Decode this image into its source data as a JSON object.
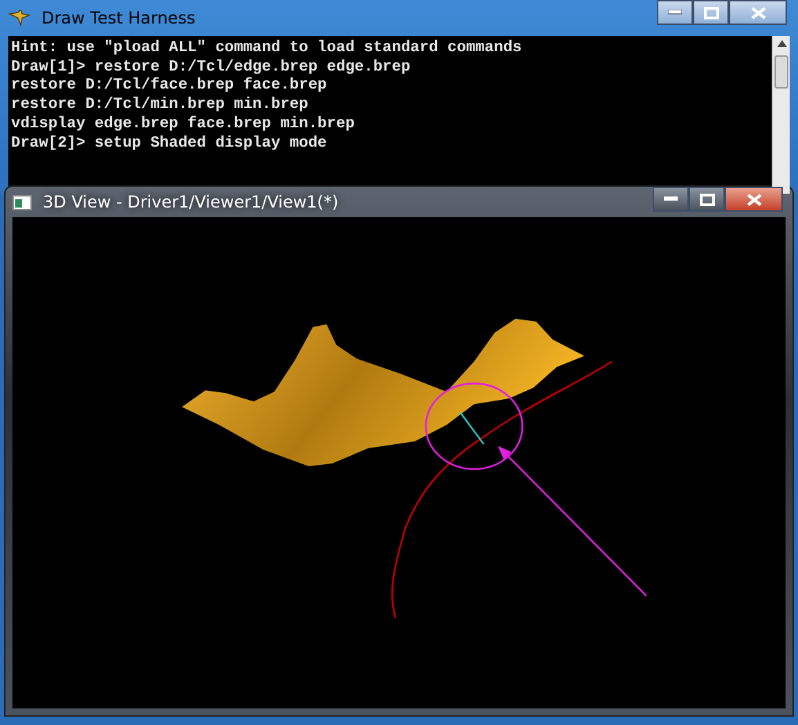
{
  "console_window": {
    "title": "Draw Test Harness",
    "lines": [
      "Hint: use \"pload ALL\" command to load standard commands",
      "Draw[1]> restore D:/Tcl/edge.brep edge.brep",
      "restore D:/Tcl/face.brep face.brep",
      "restore D:/Tcl/min.brep min.brep",
      "vdisplay edge.brep face.brep min.brep",
      "Draw[2]> setup Shaded display mode"
    ]
  },
  "viewer_window": {
    "title": "3D View - Driver1/Viewer1/View1(*)"
  }
}
